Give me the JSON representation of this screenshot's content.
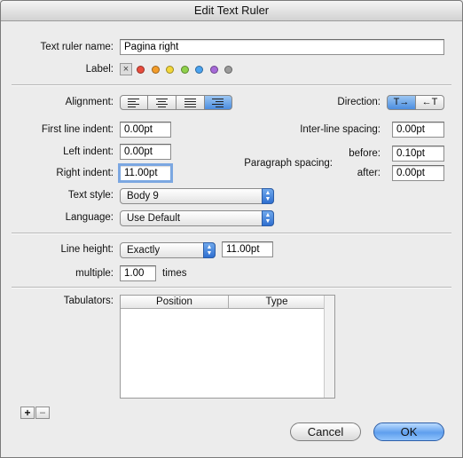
{
  "window": {
    "title": "Edit Text Ruler"
  },
  "ruler": {
    "name_label": "Text ruler name:",
    "name_value": "Pagina right",
    "label_label": "Label:",
    "label_colors": [
      "#e84c3d",
      "#f39c2a",
      "#f2d63a",
      "#8fd14b",
      "#4aa3f0",
      "#a66ad8",
      "#9b9b9b"
    ]
  },
  "alignment": {
    "label": "Alignment:",
    "options": [
      "align-left",
      "align-center",
      "align-justify",
      "align-right"
    ],
    "selected": "align-right"
  },
  "direction": {
    "label": "Direction:",
    "ltr": "T→",
    "rtl": "←T"
  },
  "indents": {
    "first_line_label": "First line indent:",
    "first_line_value": "0.00pt",
    "left_label": "Left indent:",
    "left_value": "0.00pt",
    "right_label": "Right indent:",
    "right_value": "11.00pt"
  },
  "spacing": {
    "inter_line_label": "Inter-line spacing:",
    "inter_line_value": "0.00pt",
    "paragraph_label": "Paragraph spacing:",
    "before_label": "before:",
    "before_value": "0.10pt",
    "after_label": "after:",
    "after_value": "0.00pt"
  },
  "text_style": {
    "label": "Text style:",
    "value": "Body 9"
  },
  "language": {
    "label": "Language:",
    "value": "Use Default"
  },
  "line_height": {
    "label": "Line height:",
    "mode": "Exactly",
    "value": "11.00pt",
    "multiple_label": "multiple:",
    "multiple_value": "1.00",
    "times_label": "times"
  },
  "tabulators": {
    "label": "Tabulators:",
    "columns": [
      "Position",
      "Type"
    ],
    "add": "+",
    "remove": "−"
  },
  "buttons": {
    "cancel": "Cancel",
    "ok": "OK"
  }
}
